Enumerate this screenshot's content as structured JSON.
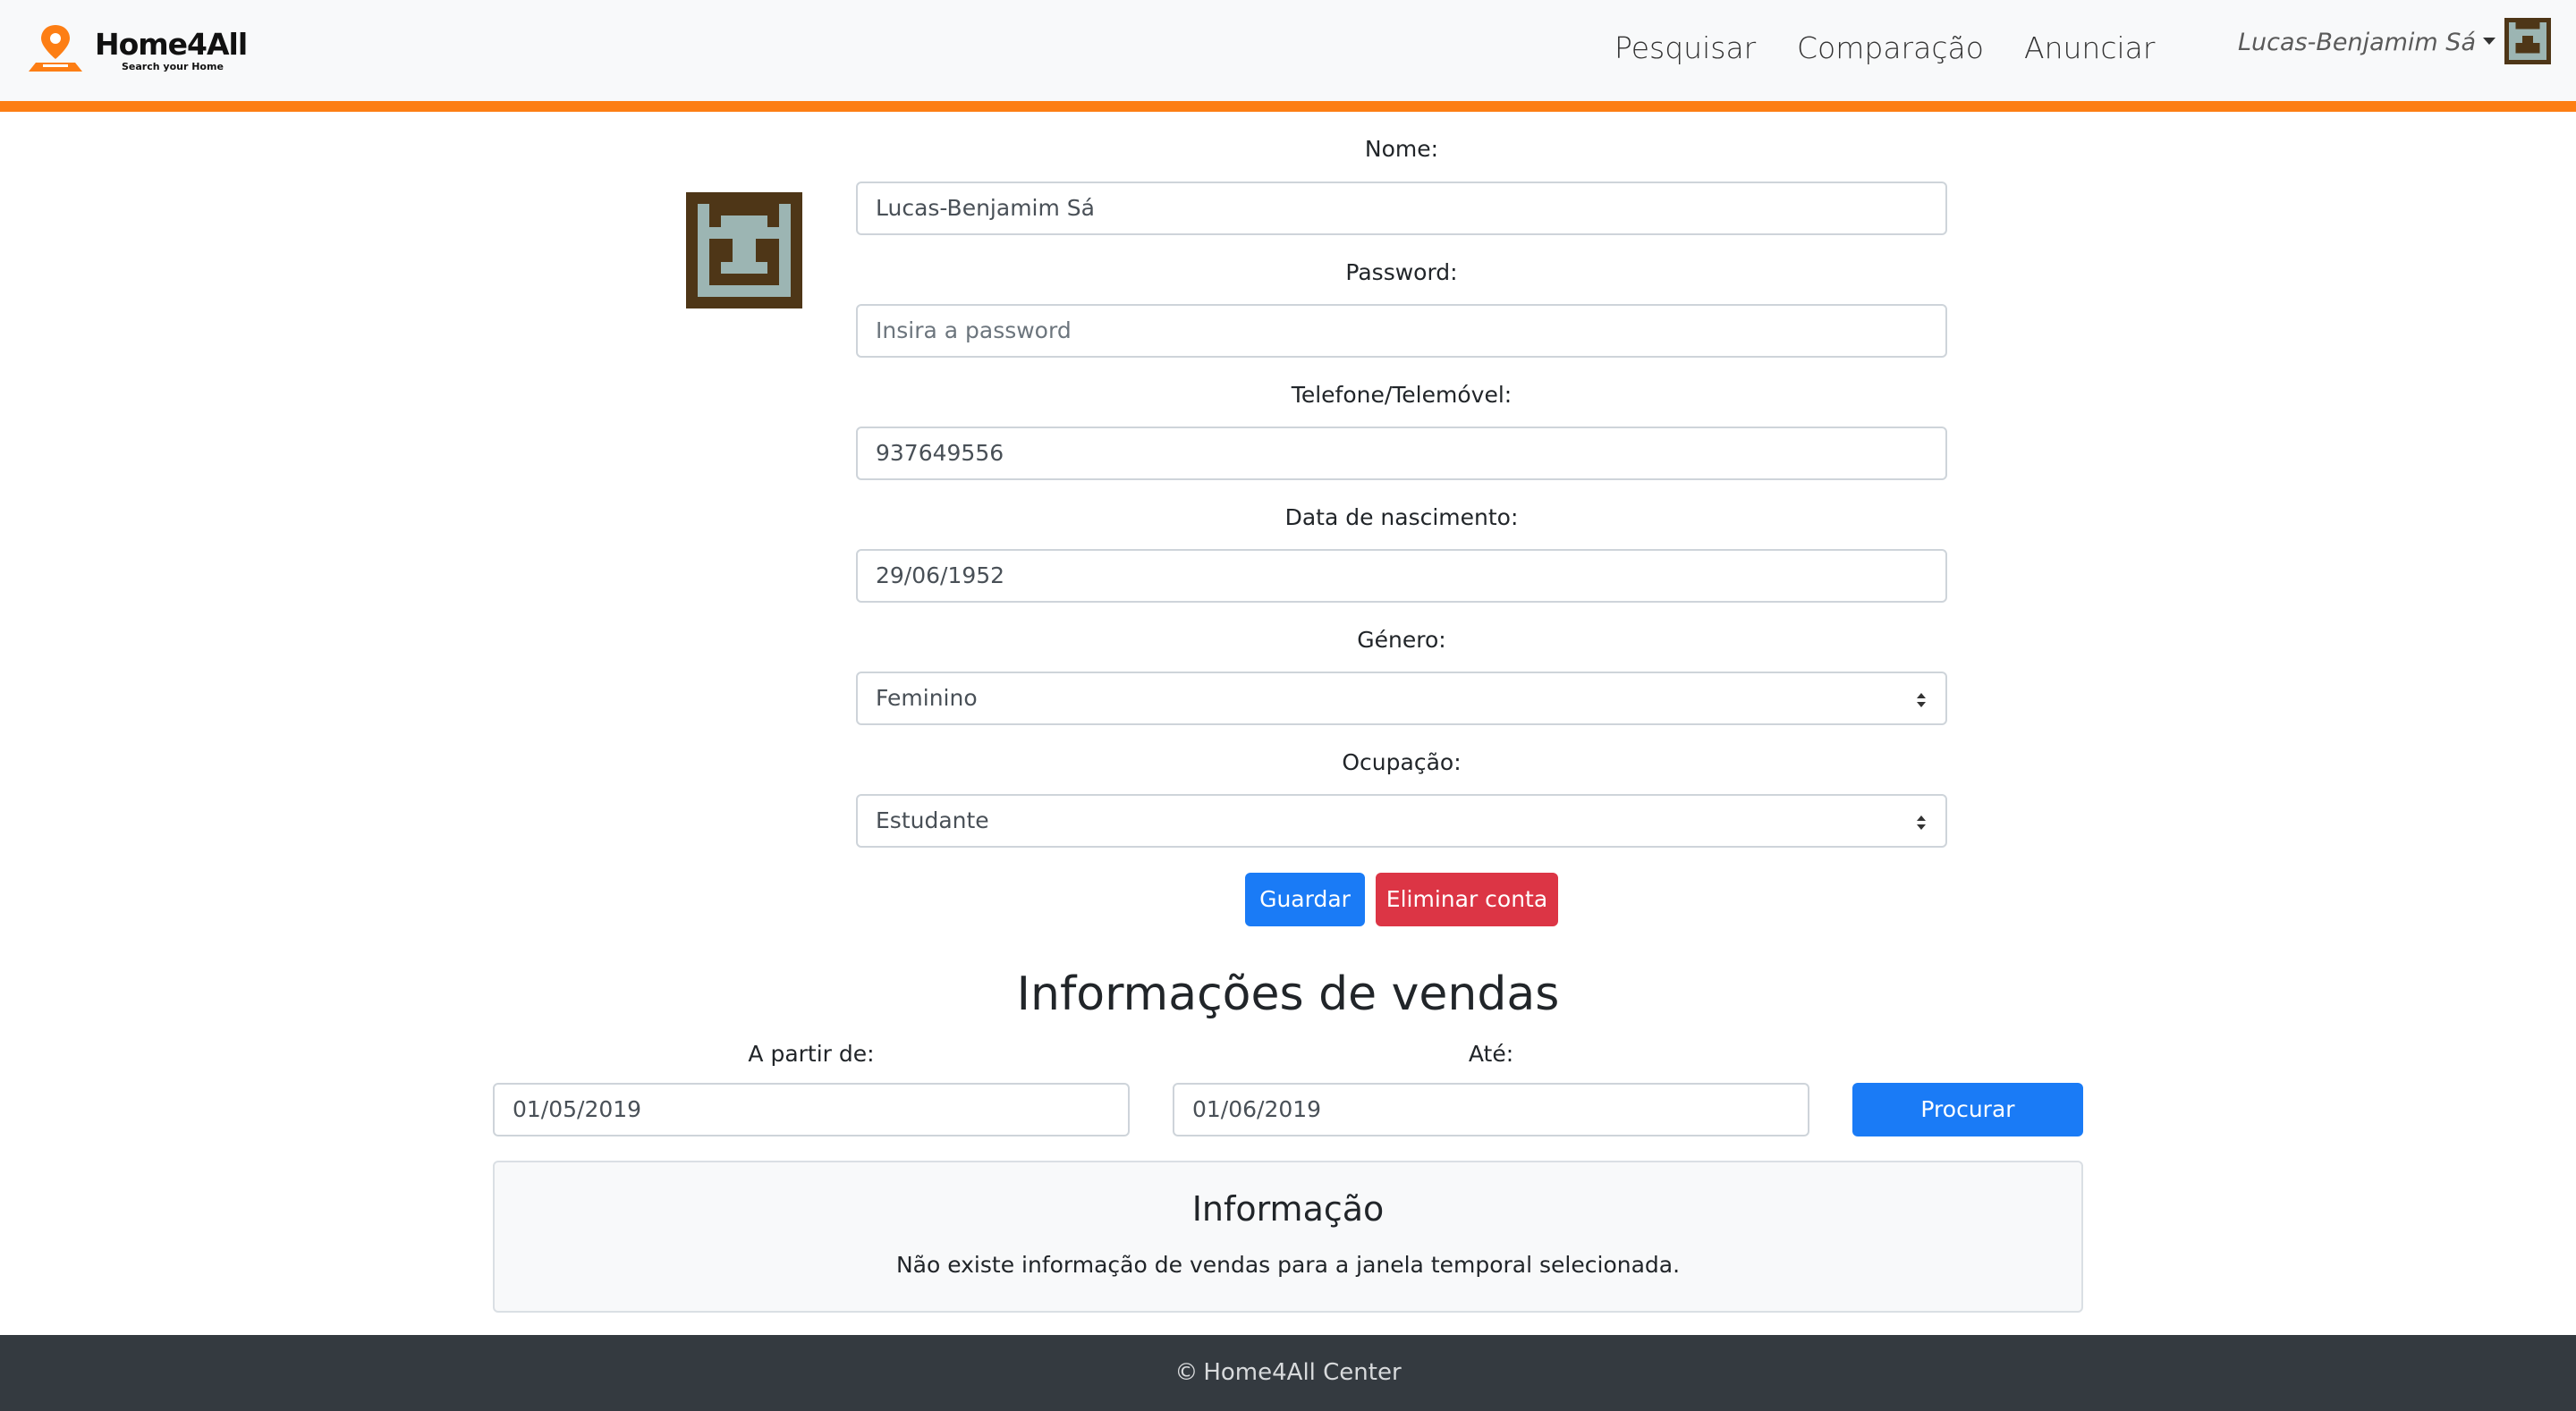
{
  "navbar": {
    "brand_name": "Home4All",
    "brand_tagline": "Search your Home",
    "links": [
      "Pesquisar",
      "Comparação",
      "Anunciar"
    ],
    "user_name": "Lucas-Benjamim Sá"
  },
  "profile": {
    "fields": [
      {
        "label": "Nome:",
        "value": "Lucas-Benjamim Sá"
      },
      {
        "label": "Password:",
        "placeholder": "Insira a password"
      },
      {
        "label": "Telefone/Telemóvel:",
        "value": "937649556"
      },
      {
        "label": "Data de nascimento:",
        "value": "29/06/1952"
      },
      {
        "label": "Género:",
        "value": "Feminino"
      },
      {
        "label": "Ocupação:",
        "value": "Estudante"
      }
    ],
    "save_label": "Guardar",
    "delete_label": "Eliminar conta"
  },
  "sales": {
    "title": "Informações de vendas",
    "from_label": "A partir de:",
    "from_value": "01/05/2019",
    "to_label": "Até:",
    "to_value": "01/06/2019",
    "search_label": "Procurar",
    "info_title": "Informação",
    "info_text": "Não existe informação de vendas para a janela temporal selecionada."
  },
  "footer": {
    "text": "Home4All Center"
  },
  "colors": {
    "accent": "#fd7e14",
    "primary": "#1a7bf6",
    "danger": "#dc3545",
    "avatar_bg": "#4e3617",
    "avatar_fg": "#9cb5b3",
    "footer_bg": "#343a40"
  }
}
